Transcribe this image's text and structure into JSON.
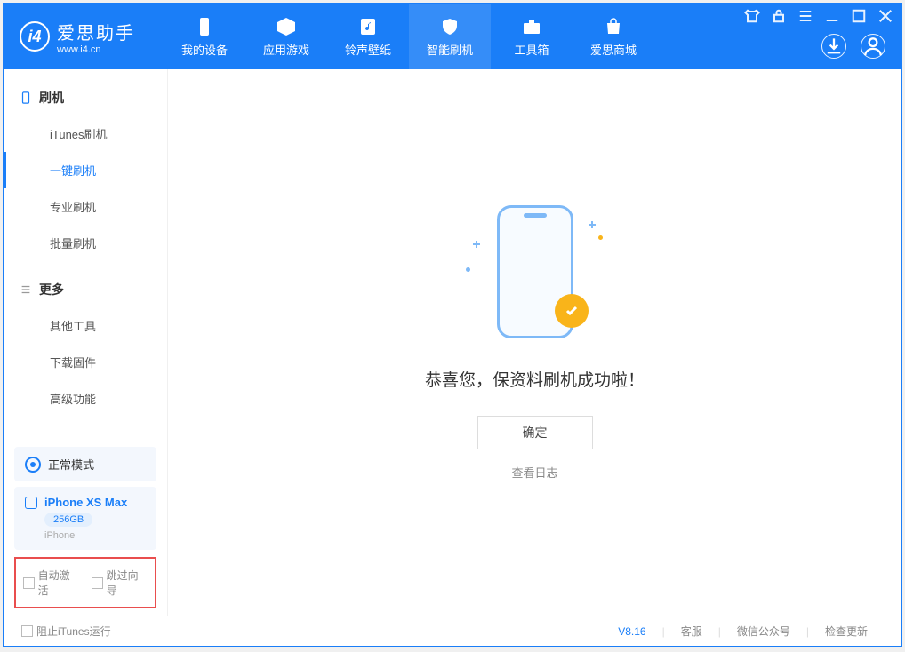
{
  "app": {
    "name": "爱思助手",
    "url": "www.i4.cn"
  },
  "nav": {
    "items": [
      {
        "label": "我的设备"
      },
      {
        "label": "应用游戏"
      },
      {
        "label": "铃声壁纸"
      },
      {
        "label": "智能刷机"
      },
      {
        "label": "工具箱"
      },
      {
        "label": "爱思商城"
      }
    ]
  },
  "sidebar": {
    "group1": {
      "title": "刷机",
      "items": [
        "iTunes刷机",
        "一键刷机",
        "专业刷机",
        "批量刷机"
      ]
    },
    "group2": {
      "title": "更多",
      "items": [
        "其他工具",
        "下载固件",
        "高级功能"
      ]
    },
    "mode": "正常模式",
    "device": {
      "name": "iPhone XS Max",
      "capacity": "256GB",
      "type": "iPhone"
    },
    "options": {
      "auto_activate": "自动激活",
      "skip_guide": "跳过向导"
    }
  },
  "main": {
    "message": "恭喜您，保资料刷机成功啦！",
    "ok": "确定",
    "log_link": "查看日志"
  },
  "footer": {
    "block_itunes": "阻止iTunes运行",
    "version": "V8.16",
    "support": "客服",
    "wechat": "微信公众号",
    "update": "检查更新"
  }
}
